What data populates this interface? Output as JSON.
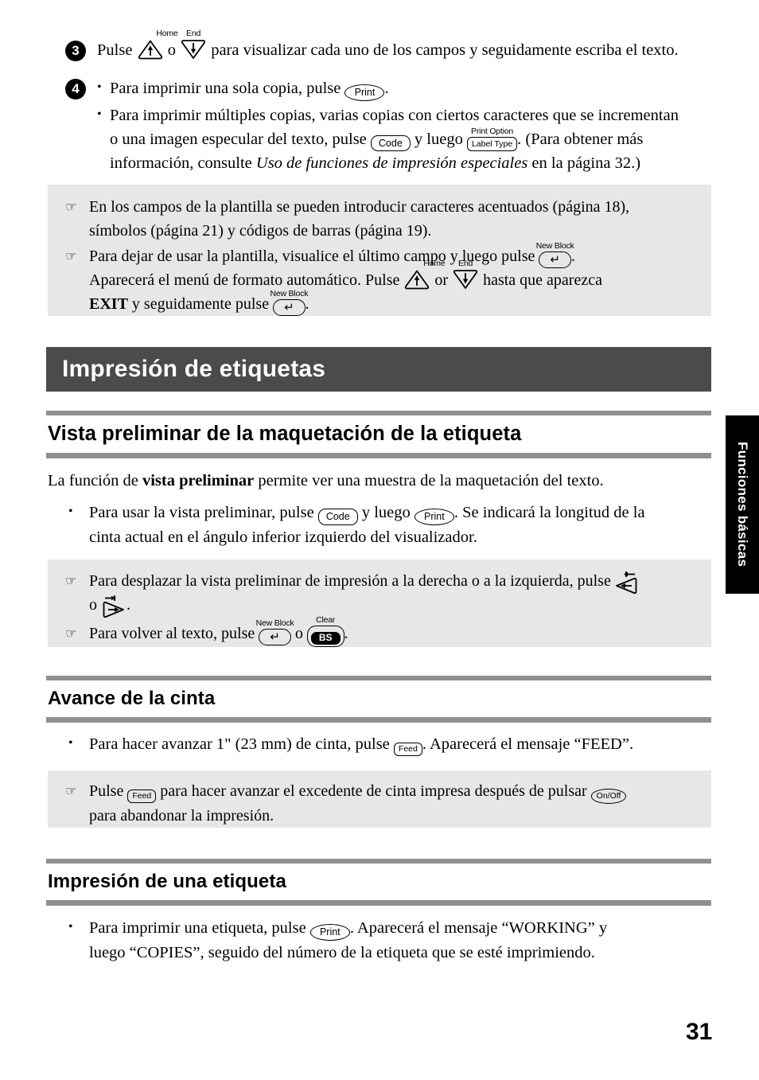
{
  "page": {
    "number": "31",
    "side_tab_label": "Funciones básicas"
  },
  "steps": [
    {
      "number": "3",
      "text_before": "Pulse",
      "key1": {
        "label": "",
        "cap": "Home",
        "name": "up-arrow-home-key"
      },
      "text_mid": "o",
      "key2": {
        "label": "",
        "cap": "End",
        "name": "down-arrow-end-key"
      },
      "text_after": "para visualizar cada uno de los campos y seguidamente escriba el texto."
    },
    {
      "number": "4",
      "bullet1_before": "Para imprimir una sola copia, pulse",
      "bullet1_key": {
        "label": "Print",
        "cap": ""
      },
      "bullet1_after": ".",
      "bullet2_line1": "Para imprimir múltiples copias, varias copias con ciertos caracteres que se incrementan",
      "bullet2_line2_before": "o una imagen especular del texto, pulse",
      "bullet2_key1": {
        "label": "Code",
        "cap": ""
      },
      "bullet2_mid": "y luego",
      "bullet2_key2": {
        "label": "Label Type",
        "cap": "Print Option"
      },
      "bullet2_line2_after": ". (Para obtener más",
      "bullet2_line3_before": "información, consulte",
      "bullet2_line3_italic": "Uso de funciones de impresión especiales",
      "bullet2_line3_after": "en la página 32.)"
    }
  ],
  "note_box_1": {
    "note1_line1": "En los campos de la plantilla se pueden introducir caracteres acentuados (página 18),",
    "note1_line2": "símbolos (página 21) y códigos de barras (página 19).",
    "note2_line1_before": "Para dejar de usar la plantilla, visualice el último campo y luego pulse",
    "note2_key1": {
      "label": "↵",
      "cap": "New Block"
    },
    "note2_line1_after": ".",
    "note2_line2_before": "Aparecerá el menú de formato automático. Pulse",
    "note2_key2": {
      "label": "",
      "cap": "Home"
    },
    "note2_line2_mid": "or",
    "note2_key3": {
      "label": "",
      "cap": "End"
    },
    "note2_line2_after": "hasta que aparezca",
    "note2_line3_bold": "EXIT",
    "note2_line3_mid": "y seguidamente pulse",
    "note2_key4": {
      "label": "↵",
      "cap": "New Block"
    },
    "note2_line3_after": "."
  },
  "chapter": {
    "title": "Impresión de etiquetas"
  },
  "sections": [
    {
      "title": "Vista preliminar de la maquetación de la etiqueta",
      "intro_before": "La función de",
      "intro_bold": "vista preliminar",
      "intro_after": "permite ver una muestra de la maquetación del texto.",
      "bullet_line1_before": "Para usar la vista preliminar, pulse",
      "bullet_key1": {
        "label": "Code",
        "cap": ""
      },
      "bullet_line1_mid": "y luego",
      "bullet_key2": {
        "label": "Print",
        "cap": ""
      },
      "bullet_line1_after": ". Se indicará la longitud de la",
      "bullet_line2": "cinta actual en el ángulo inferior izquierdo del visualizador."
    },
    {
      "title": "Avance de la cinta",
      "bullet_before": "Para hacer avanzar 1\" (23 mm) de cinta, pulse",
      "bullet_key": {
        "label": "Feed",
        "cap": ""
      },
      "bullet_after": ". Aparecerá el mensaje “FEED”."
    },
    {
      "title": "Impresión de una etiqueta",
      "bullet_line1_before": "Para imprimir una etiqueta, pulse",
      "bullet_key": {
        "label": "Print",
        "cap": ""
      },
      "bullet_line1_after": ". Aparecerá el mensaje “WORKING” y",
      "bullet_line2": "luego “COPIES”, seguido del número de la etiqueta que se esté imprimiendo."
    }
  ],
  "note_box_2": {
    "note1_line1_before": "Para desplazar la vista preliminar de impresión a la derecha o a la izquierda, pulse",
    "note1_key1": {
      "label": "◀",
      "cap": "⇤"
    },
    "note1_line2_before": "o",
    "note1_key2": {
      "label": "▶",
      "cap": "⇥"
    },
    "note1_line2_after": ".",
    "note2_before": "Para volver al texto, pulse",
    "note2_key1": {
      "label": "↵",
      "cap": "New Block"
    },
    "note2_mid": "o",
    "note2_key2": {
      "label": "BS",
      "cap": "Clear"
    },
    "note2_after": "."
  },
  "note_box_3": {
    "line1_before": "Pulse",
    "key1": {
      "label": "Feed",
      "cap": ""
    },
    "line1_mid": "para hacer avanzar el excedente de cinta impresa después de pulsar",
    "key2": {
      "label": "On/Off",
      "cap": ""
    },
    "line2": "para abandonar la impresión."
  },
  "colors": {
    "chapter_bar": "#4b4b4b",
    "rule": "#8f8f8f",
    "note_bg": "#e7e7e7",
    "side_tab": "#000000"
  }
}
